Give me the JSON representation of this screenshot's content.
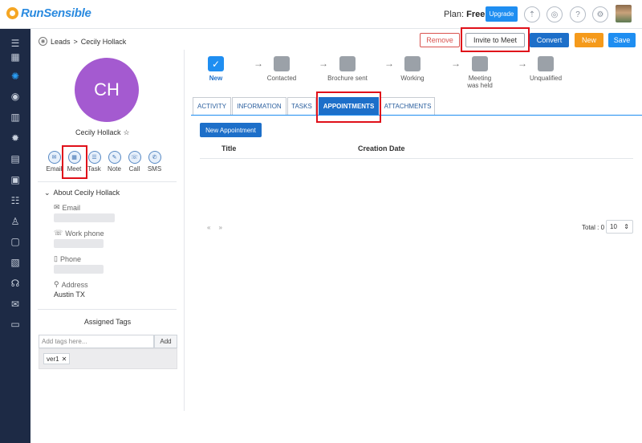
{
  "app": {
    "name": "RunSensible"
  },
  "topbar": {
    "plan_label": "Plan:",
    "plan_value": "Free",
    "upgrade_label": "Upgrade",
    "icons": [
      "upload-icon",
      "alert-icon",
      "help-icon",
      "gear-icon"
    ]
  },
  "leftnav": {
    "items": [
      "menu-icon",
      "dashboard-icon",
      "leads-icon",
      "contacts-icon",
      "companies-icon",
      "ideas-icon",
      "documents-icon",
      "calendar-board-icon",
      "filters-icon",
      "team-icon",
      "calendar-icon",
      "invoices-icon",
      "support-icon",
      "mail-icon",
      "folder-icon"
    ]
  },
  "breadcrumb": {
    "parent": "Leads",
    "separator": ">",
    "current": "Cecily Hollack"
  },
  "actions": {
    "remove": "Remove",
    "invite": "Invite to Meet",
    "convert": "Convert",
    "new": "New",
    "save": "Save"
  },
  "lead": {
    "initials": "CH",
    "name": "Cecily Hollack",
    "avatar_color": "#a45ad0",
    "quick_actions": [
      "Email",
      "Meet",
      "Task",
      "Note",
      "Call",
      "SMS"
    ],
    "about_title": "About Cecily Hollack",
    "fields": {
      "email_label": "Email",
      "work_phone_label": "Work phone",
      "phone_label": "Phone",
      "address_label": "Address",
      "address_value": "Austin TX"
    }
  },
  "tags": {
    "title": "Assigned Tags",
    "placeholder": "Add tags here...",
    "add_label": "Add",
    "items": [
      "ver1"
    ]
  },
  "stages": [
    {
      "label": "New",
      "active": true
    },
    {
      "label": "Contacted",
      "active": false
    },
    {
      "label": "Brochure sent",
      "active": false
    },
    {
      "label": "Working",
      "active": false
    },
    {
      "label": "Meeting was held",
      "active": false
    },
    {
      "label": "Unqualified",
      "active": false
    }
  ],
  "tabs": [
    {
      "label": "ACTIVITY",
      "active": false
    },
    {
      "label": "INFORMATION",
      "active": false
    },
    {
      "label": "TASKS",
      "active": false
    },
    {
      "label": "APPOINTMENTS",
      "active": true
    },
    {
      "label": "ATTACHMENTS",
      "active": false
    }
  ],
  "appointments": {
    "new_button": "New Appointment",
    "columns": [
      "Title",
      "Creation Date"
    ],
    "pager_prev": "«",
    "pager_next": "»",
    "total_label": "Total : 0",
    "per_page": "10"
  },
  "colors": {
    "primary": "#1f8ef1",
    "nav_bg": "#1d2a45",
    "highlight": "#e0101a",
    "new_button": "#f59a1b"
  }
}
